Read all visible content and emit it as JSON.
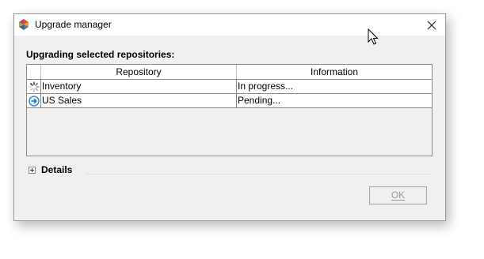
{
  "window": {
    "title": "Upgrade manager",
    "app_icon": "multicolor-app-icon",
    "close_icon": "close-icon"
  },
  "section": {
    "label": "Upgrading selected repositories:"
  },
  "table": {
    "columns": [
      "Repository",
      "Information"
    ],
    "rows": [
      {
        "status_icon": "spinner-icon",
        "repository": "Inventory",
        "information": "In progress..."
      },
      {
        "status_icon": "arrow-right-circle-icon",
        "repository": "US Sales",
        "information": "Pending..."
      }
    ]
  },
  "details": {
    "label": "Details",
    "icon": "expand-plus-icon"
  },
  "buttons": {
    "ok_label": "OK",
    "ok_enabled": false
  },
  "colors": {
    "accent_blue": "#1f7acc",
    "disabled_text": "#9a9a9a"
  }
}
